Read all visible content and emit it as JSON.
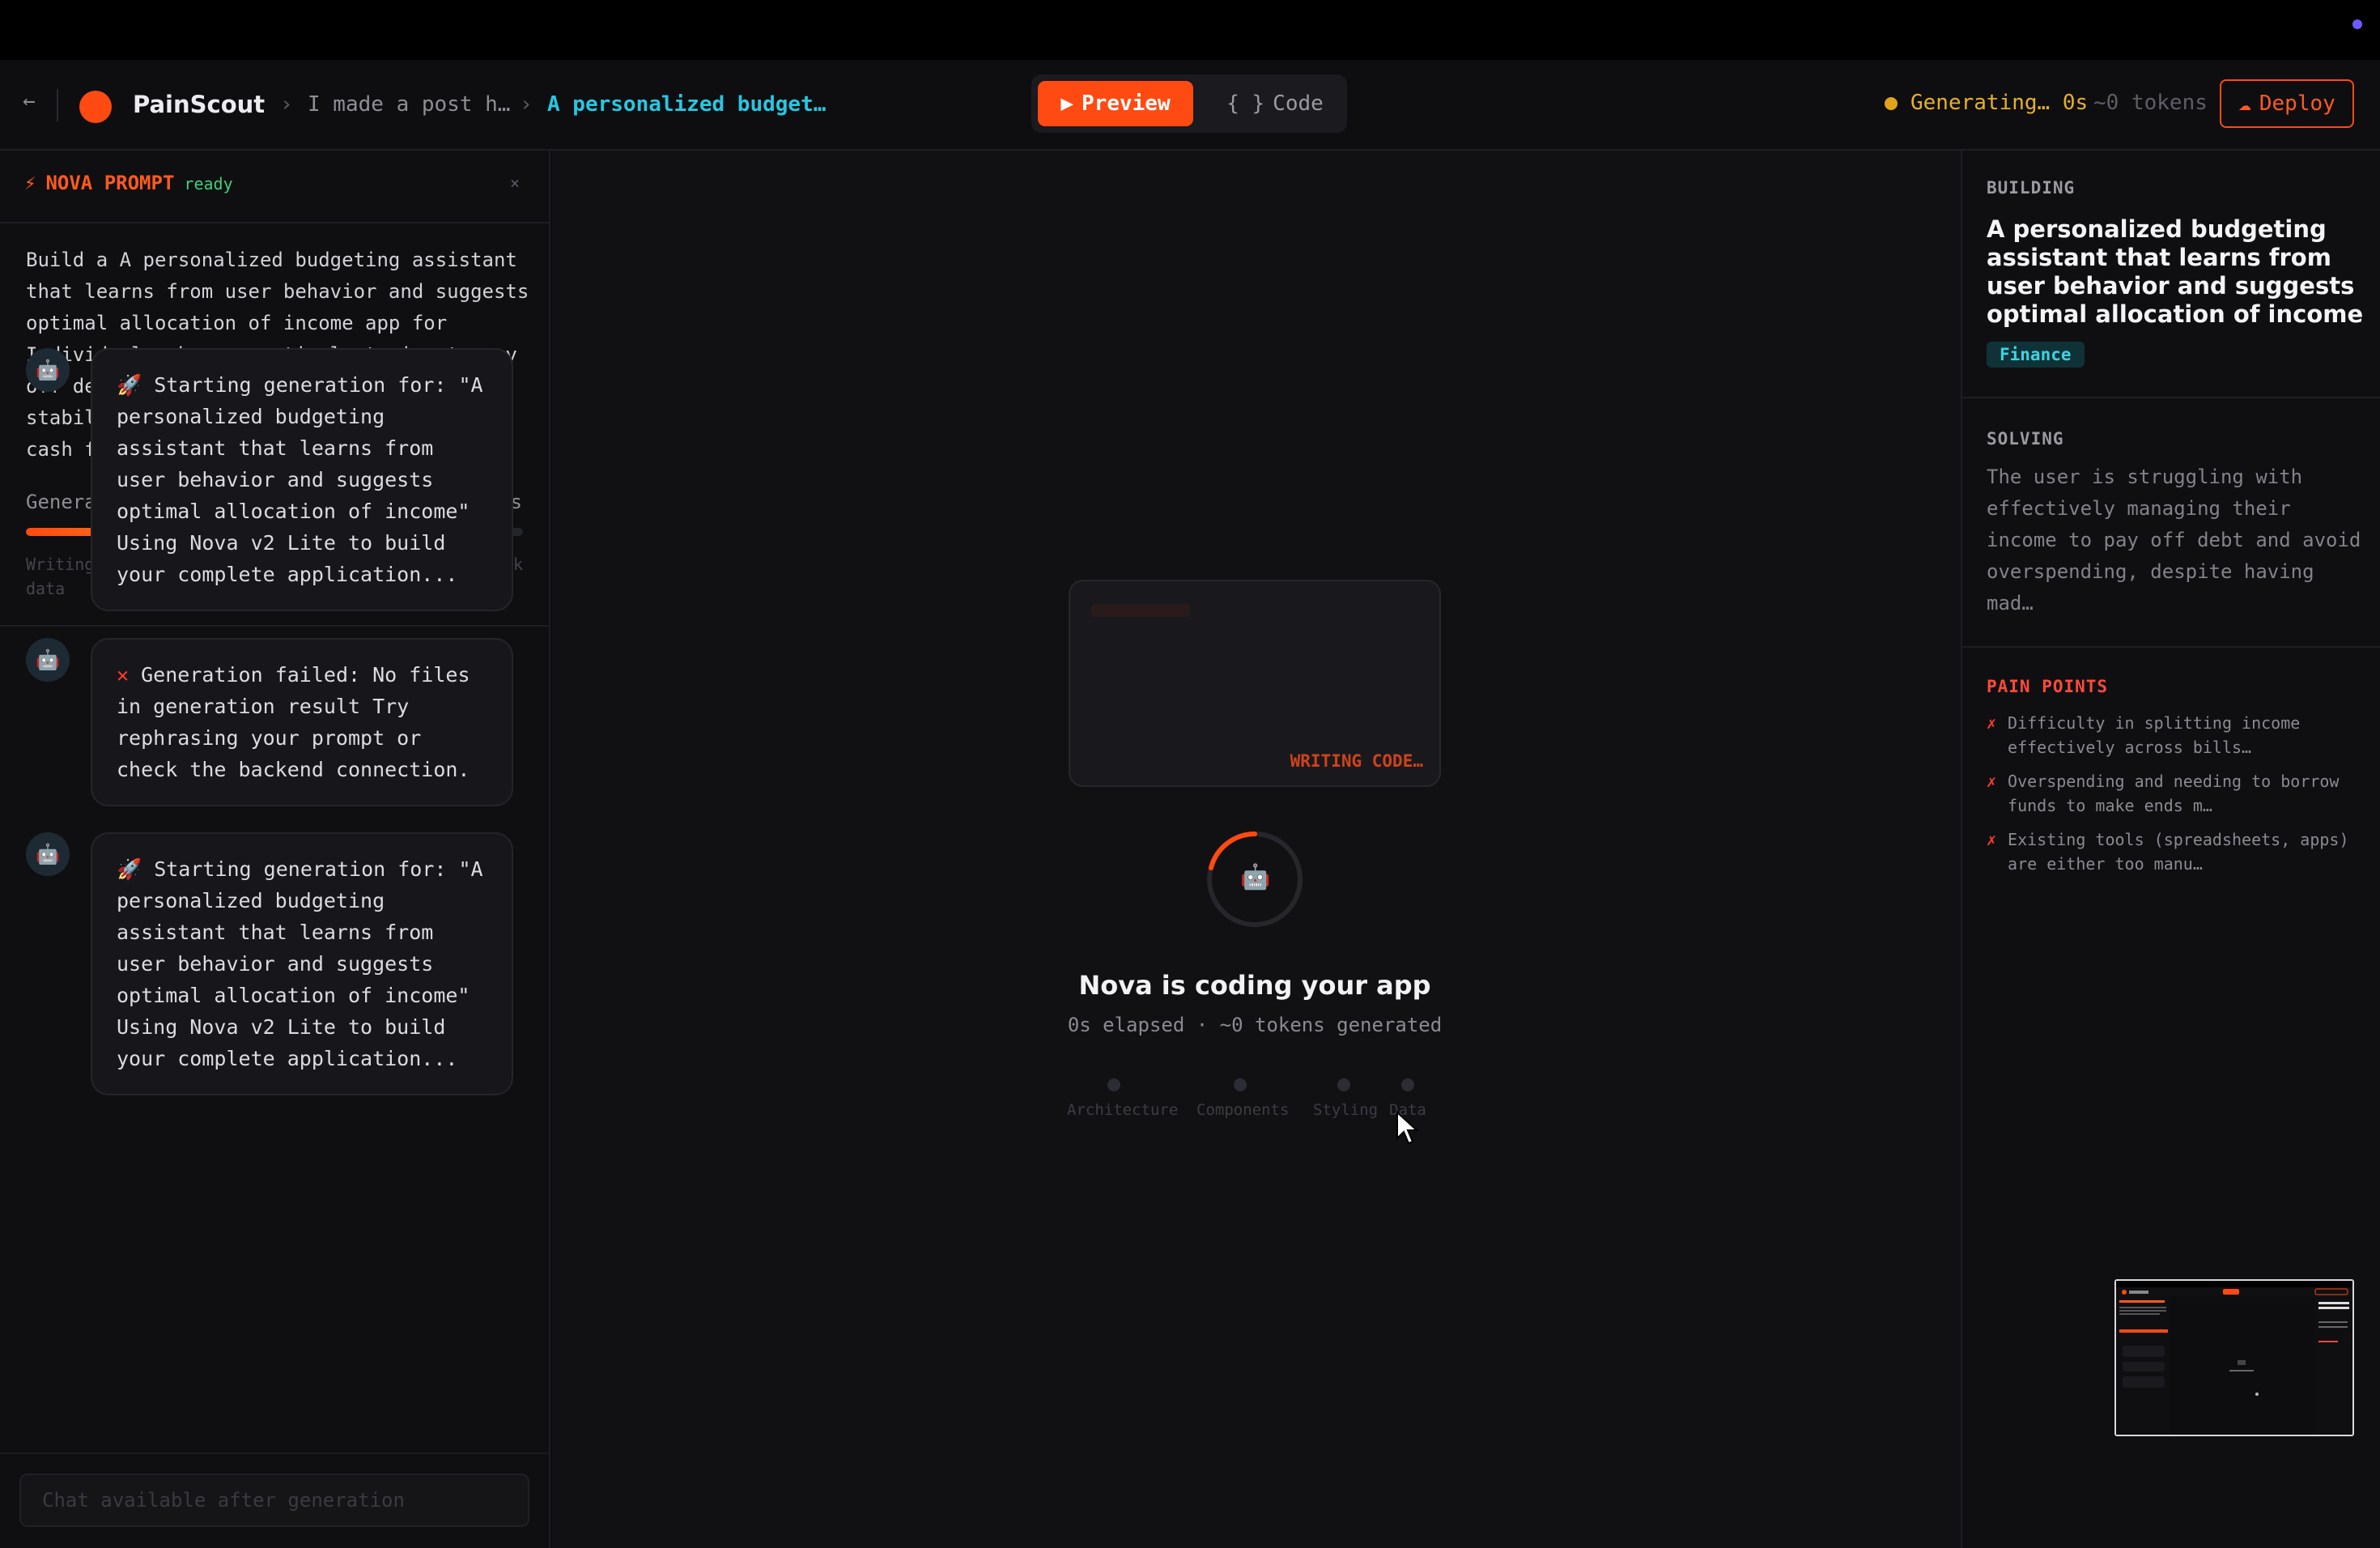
{
  "header": {
    "back_icon": "←",
    "app_name": "PainScout",
    "crumb_sep": "›",
    "crumb_1": "I made a post h…",
    "crumb_2": "A personalized budget…",
    "preview_icon": "▶",
    "preview_label": "Preview",
    "code_icon": "{ }",
    "code_label": "Code",
    "gen_status": "Generating… 0s",
    "gen_tokens": "~0 tokens",
    "deploy_icon": "☁",
    "deploy_label": "Deploy",
    "accent_color": "#ff4a12",
    "link_color": "#29c6e0"
  },
  "prompt": {
    "bolt_icon": "⚡",
    "title": "NOVA PROMPT",
    "state": "ready",
    "close_icon": "×",
    "text": "Build a A personalized budgeting assistant that learns from user behavior and suggests optimal allocation of income app for Individuals who are actively trying to pay off debt and improve their financial stability but struggle with budgeting and cash flow management",
    "progress_label": "Generating with Nova v2 Lite…",
    "progress_time": "0s",
    "progress_fraction": 0.53,
    "progress_steps": "Writing React components · Styling UI · Adding mock data"
  },
  "messages": [
    {
      "avatar_icon": "🤖",
      "emoji": "🚀",
      "text": "Starting generation for: \"A personalized budgeting assistant that learns from user behavior and suggests optimal allocation of income\" Using Nova v2 Lite to build your complete application..."
    },
    {
      "avatar_icon": "🤖",
      "emoji": "✕",
      "text": "Generation failed: No files in generation result Try rephrasing your prompt or check the backend connection."
    },
    {
      "avatar_icon": "🤖",
      "emoji": "🚀",
      "text": "Starting generation for: \"A personalized budgeting assistant that learns from user behavior and suggests optimal allocation of income\" Using Nova v2 Lite to build your complete application..."
    }
  ],
  "chat": {
    "placeholder": "Chat available after generation"
  },
  "center": {
    "writing_code": "WRITING CODE…",
    "robot_icon": "🤖",
    "title": "Nova is coding your app",
    "subtitle": "0s elapsed · ~0 tokens generated",
    "stages": [
      "Architecture",
      "Components",
      "Styling",
      "Data"
    ]
  },
  "right": {
    "building_label": "BUILDING",
    "building_title": "A personalized budgeting assistant that learns from user behavior and suggests optimal allocation of income",
    "category": "Finance",
    "solving_label": "SOLVING",
    "solving_text": "The user is struggling with effectively managing their income to pay off debt and avoid overspending, despite having mad…",
    "pain_label": "PAIN POINTS",
    "pain_color": "#ff4a3a",
    "pain_icon": "✗",
    "pain_points": [
      "Difficulty in splitting income effectively across bills…",
      "Overspending and needing to borrow funds to make ends m…",
      "Existing tools (spreadsheets, apps) are either too manu…"
    ]
  }
}
